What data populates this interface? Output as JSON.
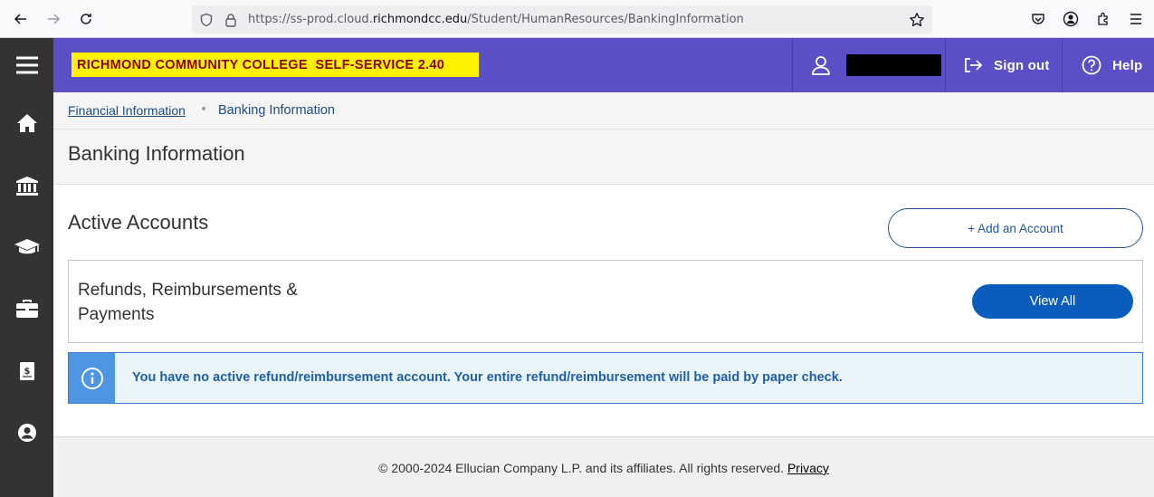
{
  "browser": {
    "url_prefix": "https://ss-prod.cloud.",
    "url_domain": "richmondcc.edu",
    "url_path": "/Student/HumanResources/BankingInformation"
  },
  "header": {
    "brand": "RICHMOND COMMUNITY COLLEGE  SELF-SERVICE 2.40",
    "sign_out": "Sign out",
    "help": "Help"
  },
  "breadcrumb": {
    "parent": "Financial Information",
    "separator": "•",
    "current": "Banking Information"
  },
  "page": {
    "title": "Banking Information"
  },
  "main": {
    "section_title": "Active Accounts",
    "add_button": "+ Add an Account",
    "card": {
      "title": "Refunds, Reimbursements & Payments",
      "view_all": "View All"
    },
    "alert": "You have no active refund/reimbursement account. Your entire refund/reimbursement will be paid by paper check."
  },
  "footer": {
    "copyright": "© 2000-2024 Ellucian Company L.P. and its affiliates. All rights reserved.",
    "privacy": "Privacy"
  },
  "colors": {
    "header": "#5a4fc7",
    "rail": "#333333",
    "brand_bg": "#fff200",
    "brand_text": "#8b0000",
    "primary": "#0b5dbd",
    "alert_side": "#4e95e4"
  },
  "icons": [
    "back-icon",
    "forward-icon",
    "reload-icon",
    "shield-icon",
    "lock-icon",
    "star-icon",
    "pocket-icon",
    "account-icon",
    "extensions-icon",
    "menu-icon",
    "hamburger-icon",
    "home-icon",
    "bank-icon",
    "graduation-cap-icon",
    "briefcase-icon",
    "ledger-icon",
    "user-circle-icon",
    "user-icon",
    "sign-out-icon",
    "help-icon",
    "info-icon"
  ]
}
